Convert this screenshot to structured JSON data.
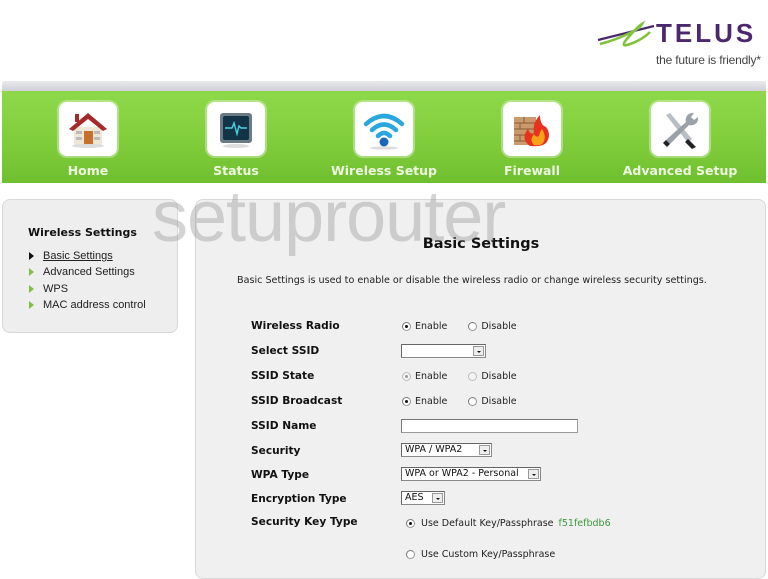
{
  "brand": {
    "name": "TELUS",
    "tagline": "the future is friendly*",
    "colors": {
      "purple": "#4b286d",
      "green": "#66cc00"
    }
  },
  "nav": {
    "bar_color": "#7fcc3a",
    "items": [
      {
        "label": "Home",
        "icon": "home-icon"
      },
      {
        "label": "Status",
        "icon": "monitor-icon"
      },
      {
        "label": "Wireless Setup",
        "icon": "wifi-icon"
      },
      {
        "label": "Firewall",
        "icon": "firewall-icon"
      },
      {
        "label": "Advanced Setup",
        "icon": "tools-icon"
      }
    ]
  },
  "sidebar": {
    "title": "Wireless Settings",
    "items": [
      {
        "label": "Basic Settings",
        "active": true
      },
      {
        "label": "Advanced Settings",
        "active": false
      },
      {
        "label": "WPS",
        "active": false
      },
      {
        "label": "MAC address control",
        "active": false
      }
    ]
  },
  "watermark": "setuprouter",
  "content": {
    "title": "Basic Settings",
    "description": "Basic Settings is used to enable or disable the wireless radio or change wireless security settings.",
    "fields": {
      "wireless_radio": {
        "label": "Wireless Radio",
        "options": [
          "Enable",
          "Disable"
        ],
        "selected": "Enable"
      },
      "select_ssid": {
        "label": "Select SSID",
        "value": ""
      },
      "ssid_state": {
        "label": "SSID State",
        "options": [
          "Enable",
          "Disable"
        ],
        "selected": "Enable",
        "disabled": true
      },
      "ssid_broadcast": {
        "label": "SSID Broadcast",
        "options": [
          "Enable",
          "Disable"
        ],
        "selected": "Enable"
      },
      "ssid_name": {
        "label": "SSID Name",
        "value": ""
      },
      "security": {
        "label": "Security",
        "value": "WPA / WPA2"
      },
      "wpa_type": {
        "label": "WPA Type",
        "value": "WPA or WPA2 - Personal"
      },
      "encryption_type": {
        "label": "Encryption Type",
        "value": "AES"
      },
      "security_key_type": {
        "label": "Security Key Type",
        "options": [
          "Use Default Key/Passphrase",
          "Use Custom Key/Passphrase"
        ],
        "selected": "Use Default Key/Passphrase",
        "default_key": "f51fefbdb6"
      }
    }
  }
}
